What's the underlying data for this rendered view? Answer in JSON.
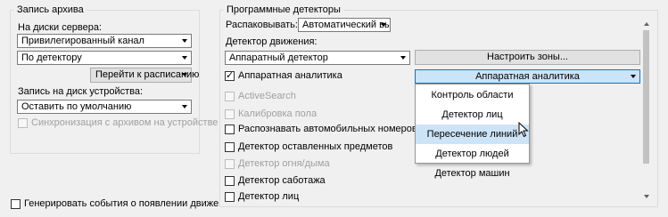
{
  "archive": {
    "title": "Запись архива",
    "server_label": "На диски сервера:",
    "channel_value": "Привилегированный канал",
    "detector_value": "По детектору",
    "goto_schedule": "Перейти к расписанию",
    "device_label": "Запись на диск устройства:",
    "device_value": "Оставить по умолчанию",
    "sync_label": "Синхронизация с архивом на устройстве"
  },
  "generate_events_label": "Генерировать события о появлении движения",
  "detectors": {
    "title": "Программные детекторы",
    "unpack_label": "Распаковывать:",
    "unpack_value": "Автоматический выбор",
    "motion_label": "Детектор движения:",
    "motion_value": "Аппаратный детектор",
    "zones_button": "Настроить зоны...",
    "hw_analytics_label": "Аппаратная аналитика",
    "hw_analytics_value": "Аппаратная аналитика",
    "items": [
      "ActiveSearch",
      "Калибровка пола",
      "Распознавать автомобильных номеров",
      "Детектор оставленных предметов",
      "Детектор огня/дыма",
      "Детектор саботажа",
      "Детектор лиц"
    ]
  },
  "dropdown": {
    "options": [
      "Контроль области",
      "Детектор лиц",
      "Пересечение линий",
      "Детектор людей",
      "Детектор машин"
    ],
    "selected_index": 2
  }
}
